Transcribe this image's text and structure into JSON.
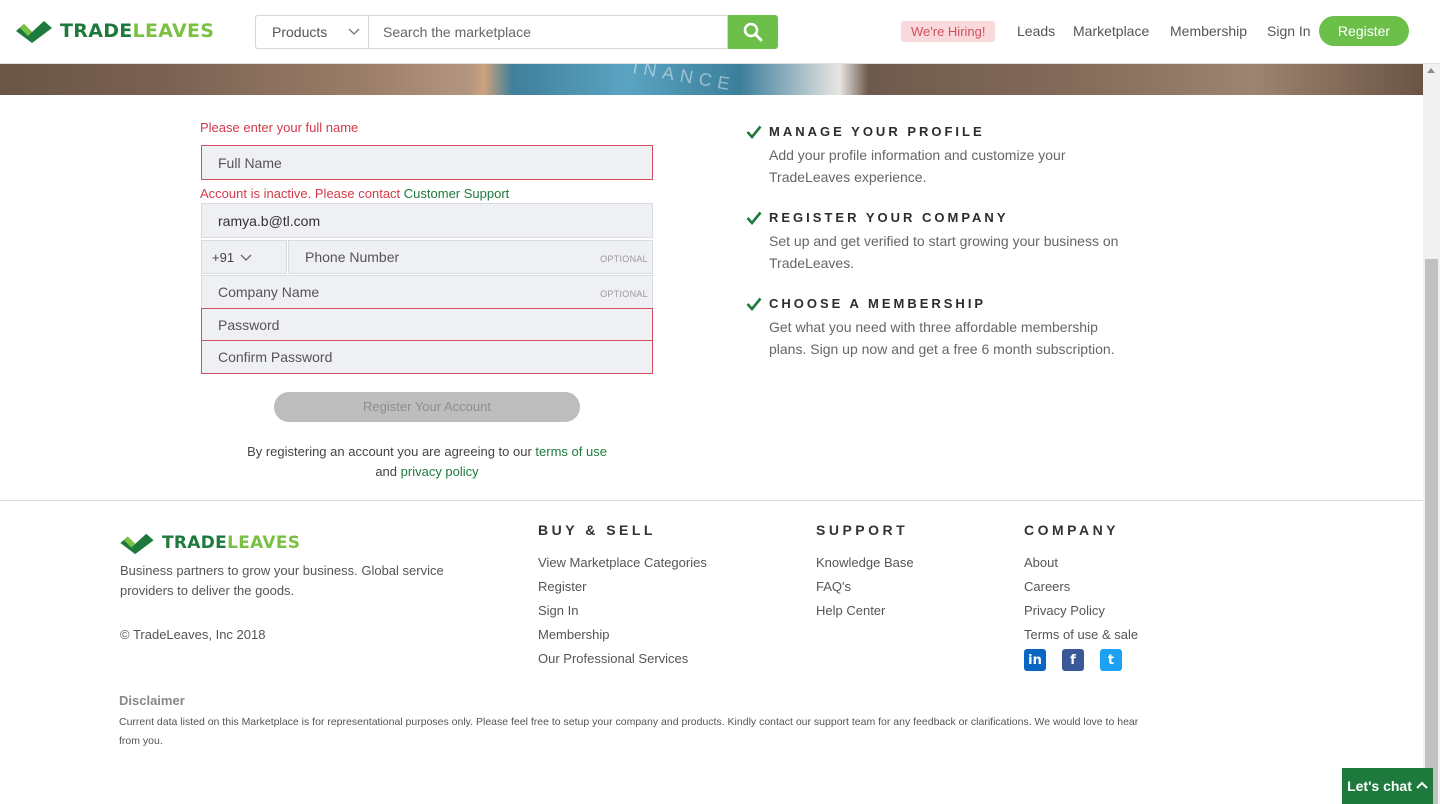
{
  "header": {
    "logo_part1": "TRADE",
    "logo_part2": "LEAVES",
    "category_select": "Products",
    "search_placeholder": "Search the marketplace",
    "hiring_badge": "We're Hiring!",
    "nav": [
      "Leads",
      "Marketplace",
      "Membership",
      "Sign In"
    ],
    "register_label": "Register"
  },
  "hero": {
    "word": "INANCE"
  },
  "form": {
    "full_name_error": "Please enter your full name",
    "full_name_placeholder": "Full Name",
    "email_error_text": "Account is inactive. Please contact ",
    "email_error_link": "Customer Support",
    "email_value": "ramya.b@tl.com",
    "country_code": "+91",
    "phone_placeholder": "Phone Number",
    "optional_label": "OPTIONAL",
    "company_placeholder": "Company Name",
    "password_placeholder": "Password",
    "confirm_password_placeholder": "Confirm Password",
    "submit_label": "Register Your Account",
    "terms_prefix": "By registering an account you are agreeing to our ",
    "terms_link": "terms of use",
    "terms_and": " and ",
    "privacy_link": "privacy policy"
  },
  "benefits": [
    {
      "title": "MANAGE YOUR PROFILE",
      "desc": "Add your profile information and customize your TradeLeaves experience."
    },
    {
      "title": "REGISTER YOUR COMPANY",
      "desc": "Set up and get verified to start growing your business on TradeLeaves."
    },
    {
      "title": "CHOOSE A MEMBERSHIP",
      "desc": "Get what you need with three affordable membership plans. Sign up now and get a free 6 month subscription."
    }
  ],
  "footer": {
    "tagline": "Business partners to grow your business. Global service providers to deliver the goods.",
    "copyright": "© TradeLeaves, Inc 2018",
    "columns": [
      {
        "heading": "BUY & SELL",
        "items": [
          "View Marketplace Categories",
          "Register",
          "Sign In",
          "Membership",
          "Our Professional Services"
        ]
      },
      {
        "heading": "SUPPORT",
        "items": [
          "Knowledge Base",
          "FAQ's",
          "Help Center"
        ]
      },
      {
        "heading": "COMPANY",
        "items": [
          "About",
          "Careers",
          "Privacy Policy",
          "Terms of use & sale"
        ]
      }
    ],
    "social": {
      "linkedin": "in",
      "facebook": "f",
      "twitter": "t"
    },
    "disclaimer_heading": "Disclaimer",
    "disclaimer": "Current data listed on this Marketplace is for representational purposes only. Please feel free to setup your company and products. Kindly contact our support team for any feedback or clarifications. We would love to hear from you."
  },
  "chat": {
    "label": "Let's chat"
  },
  "colors": {
    "brand_dark": "#1e7a3c",
    "brand_light": "#7ac143",
    "button_green": "#6cc04a",
    "error": "#d23a4b"
  }
}
